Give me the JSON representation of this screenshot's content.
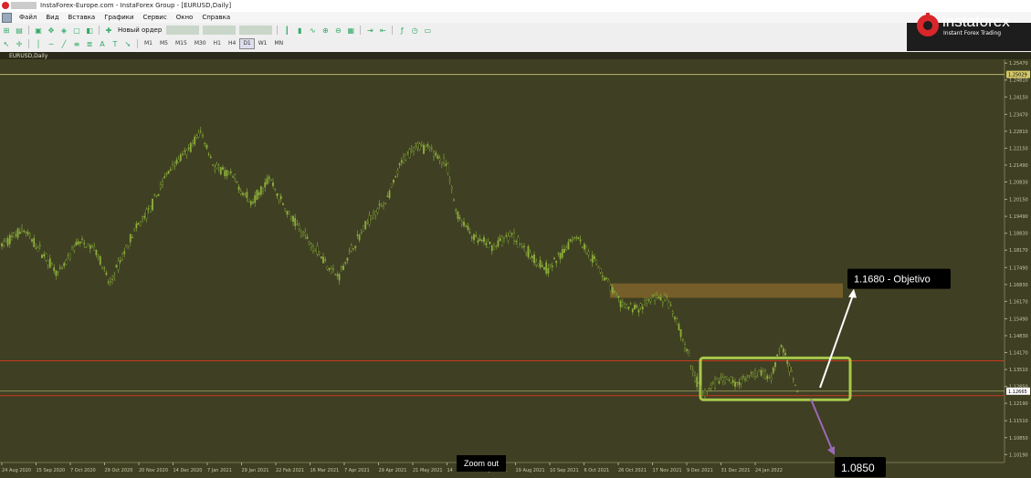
{
  "window": {
    "title": "InstaForex-Europe.com - InstaForex Group - [EURUSD,Daily]"
  },
  "menu": {
    "items": [
      "Файл",
      "Вид",
      "Вставка",
      "Графики",
      "Сервис",
      "Окно",
      "Справка"
    ]
  },
  "toolbar": {
    "new_order_label": "Новый ордер",
    "timeframes": [
      "M1",
      "M5",
      "M15",
      "M30",
      "H1",
      "H4",
      "D1",
      "W1",
      "MN"
    ],
    "active_timeframe": "D1"
  },
  "logo": {
    "name": "instaforex",
    "tagline": "Instant Forex Trading"
  },
  "zoom_tooltip": "Zoom out",
  "chart_data": {
    "type": "candlestick",
    "symbol_label": "EURUSD,Daily",
    "y_axis": {
      "ticks": [
        "1.25470",
        "1.24810",
        "1.24150",
        "1.23470",
        "1.22810",
        "1.22150",
        "1.21490",
        "1.20830",
        "1.20150",
        "1.19490",
        "1.18830",
        "1.18170",
        "1.17490",
        "1.16830",
        "1.16170",
        "1.15490",
        "1.14830",
        "1.14170",
        "1.13510",
        "1.12850",
        "1.12190",
        "1.11510",
        "1.10850",
        "1.10190"
      ],
      "range": [
        1.0988,
        1.2562
      ],
      "current_price_label": "1.12665",
      "top_line_label": "1.25029"
    },
    "x_axis": {
      "ticks": [
        "24 Aug 2020",
        "15 Sep 2020",
        "7 Oct 2020",
        "29 Oct 2020",
        "20 Nov 2020",
        "14 Dec 2020",
        "7 Jan 2021",
        "29 Jan 2021",
        "22 Feb 2021",
        "16 Mar 2021",
        "7 Apr 2021",
        "29 Apr 2021",
        "21 May 2021",
        "14",
        "28 Jul 2021",
        "19 Aug 2021",
        "10 Sep 2021",
        "6 Oct 2021",
        "26 Oct 2021",
        "17 Nov 2021",
        "9 Dec 2021",
        "31 Dec 2021",
        "24 Jan 2022"
      ]
    },
    "price_path": [
      [
        0,
        1.183
      ],
      [
        25,
        1.19
      ],
      [
        50,
        1.179
      ],
      [
        65,
        1.172
      ],
      [
        85,
        1.185
      ],
      [
        105,
        1.182
      ],
      [
        120,
        1.168
      ],
      [
        145,
        1.188
      ],
      [
        165,
        1.198
      ],
      [
        185,
        1.213
      ],
      [
        205,
        1.22
      ],
      [
        220,
        1.228
      ],
      [
        235,
        1.214
      ],
      [
        255,
        1.21
      ],
      [
        275,
        1.2
      ],
      [
        295,
        1.21
      ],
      [
        315,
        1.196
      ],
      [
        335,
        1.187
      ],
      [
        355,
        1.178
      ],
      [
        370,
        1.171
      ],
      [
        385,
        1.182
      ],
      [
        405,
        1.194
      ],
      [
        425,
        1.202
      ],
      [
        440,
        1.216
      ],
      [
        455,
        1.223
      ],
      [
        475,
        1.22
      ],
      [
        490,
        1.214
      ],
      [
        500,
        1.196
      ],
      [
        520,
        1.186
      ],
      [
        540,
        1.183
      ],
      [
        560,
        1.188
      ],
      [
        580,
        1.18
      ],
      [
        600,
        1.174
      ],
      [
        615,
        1.18
      ],
      [
        630,
        1.188
      ],
      [
        650,
        1.178
      ],
      [
        665,
        1.17
      ],
      [
        680,
        1.16
      ],
      [
        700,
        1.159
      ],
      [
        715,
        1.163
      ],
      [
        730,
        1.162
      ],
      [
        745,
        1.15
      ],
      [
        760,
        1.133
      ],
      [
        770,
        1.125
      ],
      [
        790,
        1.132
      ],
      [
        810,
        1.13
      ],
      [
        830,
        1.134
      ],
      [
        845,
        1.132
      ],
      [
        855,
        1.145
      ],
      [
        865,
        1.135
      ],
      [
        875,
        1.127
      ]
    ],
    "levels": {
      "red_line": 1.1385,
      "red_line_low": 1.1249,
      "objective_zone": [
        1.1645,
        1.168
      ],
      "range_box": [
        1.124,
        1.1375
      ]
    },
    "annotations": {
      "objective_label": "1.1680 - Objetivo",
      "target_down_label": "1.0850"
    },
    "colors": {
      "background": "#3f3f23",
      "candle": "#8db03b",
      "grid_text": "#c8c8a8",
      "zone": "#8a6a2e",
      "box": "#a8c84a",
      "red_line": "#c83a1e",
      "up_arrow": "#ffffff",
      "down_arrow": "#9a6ab8"
    }
  }
}
